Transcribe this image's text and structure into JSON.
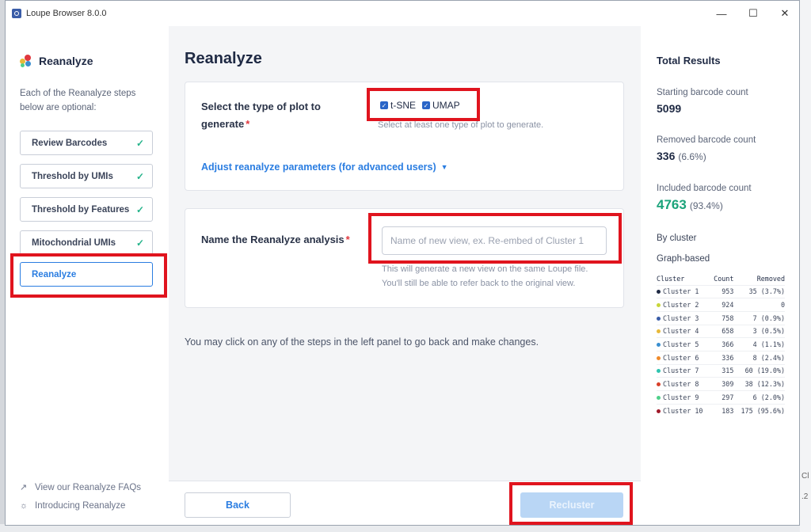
{
  "window": {
    "title": "Loupe Browser 8.0.0"
  },
  "window_controls": {
    "minimize": "—",
    "maximize": "☐",
    "close": "✕"
  },
  "sidebar": {
    "title": "Reanalyze",
    "description": "Each of the Reanalyze steps below are optional:",
    "steps": [
      {
        "label": "Review Barcodes",
        "done": true
      },
      {
        "label": "Threshold by UMIs",
        "done": true
      },
      {
        "label": "Threshold by Features",
        "done": true
      },
      {
        "label": "Mitochondrial UMIs",
        "done": true
      },
      {
        "label": "Reanalyze",
        "done": false,
        "active": true
      }
    ],
    "check_glyph": "✓",
    "links": [
      {
        "label": "View our Reanalyze FAQs",
        "icon": "external-link-icon"
      },
      {
        "label": "Introducing Reanalyze",
        "icon": "lightbulb-icon"
      }
    ]
  },
  "main": {
    "title": "Reanalyze",
    "plot_type": {
      "label": "Select the type of plot to generate",
      "required_mark": "*",
      "options": [
        {
          "label": "t-SNE",
          "checked": true
        },
        {
          "label": "UMAP",
          "checked": true
        }
      ],
      "hint": "Select at least one type of plot to generate."
    },
    "advanced_link": "Adjust reanalyze parameters (for advanced users)",
    "name_field": {
      "label": "Name the Reanalyze analysis",
      "required_mark": "*",
      "value": "",
      "placeholder": "Name of new view, ex. Re-embed of Cluster 1",
      "hint_line1": "This will generate a new view on the same Loupe file.",
      "hint_line2": "You'll still be able to refer back to the original view."
    },
    "info_text": "You may click on any of the steps in the left panel to go back and make changes.",
    "back_button": "Back",
    "recluster_button": "Recluster"
  },
  "results": {
    "title": "Total Results",
    "starting_label": "Starting barcode count",
    "starting_value": "5099",
    "removed_label": "Removed barcode count",
    "removed_value": "336",
    "removed_pct": "(6.6%)",
    "included_label": "Included barcode count",
    "included_value": "4763",
    "included_pct": "(93.4%)",
    "by_cluster_label": "By cluster",
    "clustering_label": "Graph-based",
    "table_headers": {
      "cluster": "Cluster",
      "count": "Count",
      "removed": "Removed"
    },
    "clusters": [
      {
        "name": "Cluster 1",
        "count": "953",
        "removed": "35 (3.7%)",
        "color": "#1f2a44"
      },
      {
        "name": "Cluster 2",
        "count": "924",
        "removed": "0",
        "color": "#c8d63a"
      },
      {
        "name": "Cluster 3",
        "count": "758",
        "removed": "7 (0.9%)",
        "color": "#3a5da8"
      },
      {
        "name": "Cluster 4",
        "count": "658",
        "removed": "3 (0.5%)",
        "color": "#e8b93a"
      },
      {
        "name": "Cluster 5",
        "count": "366",
        "removed": "4 (1.1%)",
        "color": "#3a8fd0"
      },
      {
        "name": "Cluster 6",
        "count": "336",
        "removed": "8 (2.4%)",
        "color": "#f08a2a"
      },
      {
        "name": "Cluster 7",
        "count": "315",
        "removed": "60 (19.0%)",
        "color": "#2fc4b0"
      },
      {
        "name": "Cluster 8",
        "count": "309",
        "removed": "38 (12.3%)",
        "color": "#d8402a"
      },
      {
        "name": "Cluster 9",
        "count": "297",
        "removed": "6 (2.0%)",
        "color": "#4fd08a"
      },
      {
        "name": "Cluster 10",
        "count": "183",
        "removed": "175 (95.6%)",
        "color": "#a01a2a"
      }
    ]
  },
  "background": {
    "right_edge_text_1": "Cl",
    "right_edge_text_2": ".2"
  },
  "colors": {
    "accent": "#2a7de1",
    "success": "#25b38a",
    "highlight": "#e0141e",
    "required": "#e0383e"
  }
}
